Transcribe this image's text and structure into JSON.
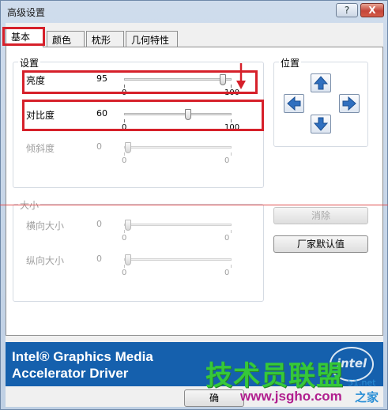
{
  "window": {
    "title": "高级设置",
    "help_label": "?",
    "close_label": "X"
  },
  "tabs": [
    {
      "label": "基本"
    },
    {
      "label": "颜色"
    },
    {
      "label": "枕形"
    },
    {
      "label": "几何特性"
    }
  ],
  "settings": {
    "group_label": "设置",
    "brightness": {
      "label": "亮度",
      "value": "95",
      "min": "0",
      "max": "100",
      "level": 95
    },
    "contrast": {
      "label": "对比度",
      "value": "60",
      "min": "0",
      "max": "100",
      "level": 60
    },
    "tilt": {
      "label": "倾斜度",
      "value": "0",
      "min": "0",
      "max": "0",
      "level": 0
    }
  },
  "position": {
    "group_label": "位置",
    "icons": [
      "arrow-up-icon",
      "arrow-left-icon",
      "arrow-right-icon",
      "arrow-down-icon"
    ]
  },
  "size": {
    "group_label": "大小",
    "horizontal": {
      "label": "横向大小",
      "value": "0",
      "min": "0",
      "max": "0",
      "level": 0
    },
    "vertical": {
      "label": "纵向大小",
      "value": "0",
      "min": "0",
      "max": "0",
      "level": 0
    }
  },
  "buttons": {
    "undo": "消除",
    "factory_default": "厂家默认值",
    "ok": "确"
  },
  "banner": {
    "line1": "Intel® Graphics Media",
    "line2": "Accelerator Driver",
    "logo": "intel"
  },
  "watermark": {
    "main": "技术员联盟",
    "url": "www.jsgho.com",
    "tail": "51.net",
    "cn": "之家"
  },
  "colors": {
    "highlight": "#d6202a",
    "banner": "#1560ad",
    "arrow": "#2f6fbf"
  }
}
